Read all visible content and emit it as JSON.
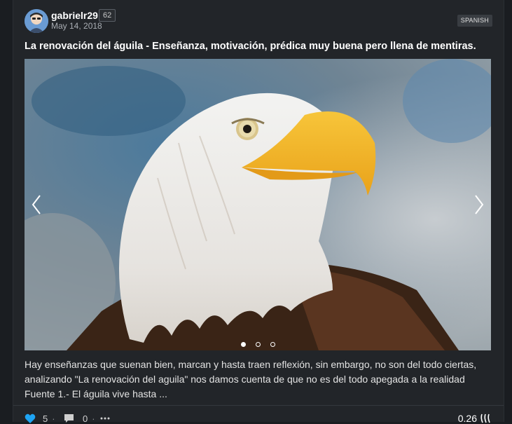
{
  "post": {
    "author": "gabrielr29",
    "reputation": "62",
    "date": "May 14, 2018",
    "tag": "SPANISH",
    "title": "La renovación del águila - Enseñanza, motivación, prédica muy buena pero llena de mentiras.",
    "excerpt": "Hay enseñanzas que suenan bien, marcan y hasta traen reflexión, sin embargo, no son del todo ciertas, analizando \"La renovación del aguila\" nos damos cuenta de que no es del todo apegada a la realidad Fuente 1.- El águila vive hasta ..."
  },
  "carousel": {
    "image_subject": "bald eagle head",
    "slides": 3,
    "active_slide": 1
  },
  "footer": {
    "votes": "5",
    "comments": "0",
    "payout": "0.26"
  },
  "icons": {
    "vote": "heart-icon",
    "comment": "comment-icon",
    "more": "more-dots-icon",
    "currency": "steem-icon",
    "prev": "chevron-left-icon",
    "next": "chevron-right-icon"
  },
  "colors": {
    "background": "#1a1d21",
    "card": "#222529",
    "vote_accent": "#1ea4f4",
    "text": "#e8e8e8"
  }
}
